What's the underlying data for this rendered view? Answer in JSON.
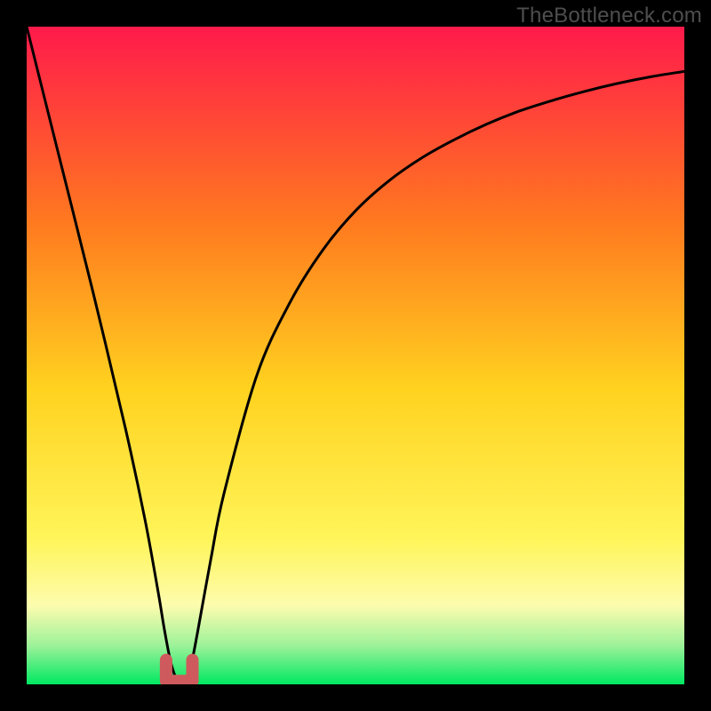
{
  "watermark": "TheBottleneck.com",
  "colors": {
    "frame": "#000000",
    "grad_top": "#ff1a4b",
    "grad_upper_mid": "#ff7a1f",
    "grad_mid": "#ffd21f",
    "grad_lower_mid": "#fff55a",
    "grad_pale": "#fdfcae",
    "grad_green1": "#9ff29a",
    "grad_green2": "#00e861",
    "curve_stroke": "#000000",
    "marker_stroke": "#cf5a5d",
    "watermark_text": "#4e4e4e"
  },
  "chart_data": {
    "type": "line",
    "title": "",
    "xlabel": "",
    "ylabel": "",
    "xlim": [
      0,
      100
    ],
    "ylim": [
      0,
      100
    ],
    "series": [
      {
        "name": "bottleneck-curve",
        "x": [
          0,
          5,
          10,
          15,
          18,
          20,
          21,
          22,
          23,
          24,
          25,
          26,
          28,
          30,
          35,
          40,
          45,
          50,
          55,
          60,
          65,
          70,
          75,
          80,
          85,
          90,
          95,
          100
        ],
        "y": [
          100,
          80,
          60,
          39,
          25,
          14,
          8,
          3,
          0.5,
          0.5,
          3,
          8,
          19,
          29,
          47,
          58,
          66,
          72,
          76.5,
          80,
          82.8,
          85.2,
          87.2,
          88.8,
          90.2,
          91.4,
          92.4,
          93.2
        ]
      }
    ],
    "marker": {
      "name": "min-region",
      "x_range": [
        21.2,
        25.2
      ],
      "y": 0.5
    },
    "gradient_stops": [
      {
        "pos": 0.0,
        "color": "#ff1a4b"
      },
      {
        "pos": 0.3,
        "color": "#ff7a1f"
      },
      {
        "pos": 0.55,
        "color": "#ffd21f"
      },
      {
        "pos": 0.78,
        "color": "#fff55a"
      },
      {
        "pos": 0.88,
        "color": "#fdfcae"
      },
      {
        "pos": 0.94,
        "color": "#9ff29a"
      },
      {
        "pos": 1.0,
        "color": "#00e861"
      }
    ]
  }
}
